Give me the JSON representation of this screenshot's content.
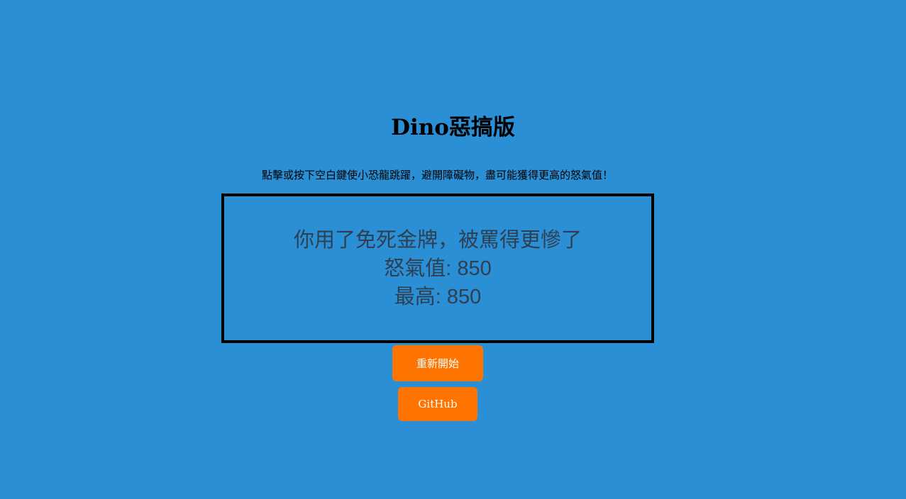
{
  "page": {
    "title": "Dino惡搞版",
    "instructions": "點擊或按下空白鍵使小恐龍跳躍，避開障礙物，盡可能獲得更高的怒氣值！"
  },
  "game": {
    "message": "你用了免死金牌，被罵得更慘了",
    "score_label": "怒氣值: 850",
    "best_label": "最高: 850"
  },
  "buttons": {
    "restart_label": "重新開始",
    "github_label": "GitHub"
  },
  "colors": {
    "background": "#2a8fd5",
    "button": "#ff7400",
    "text": "#2f3f52"
  }
}
